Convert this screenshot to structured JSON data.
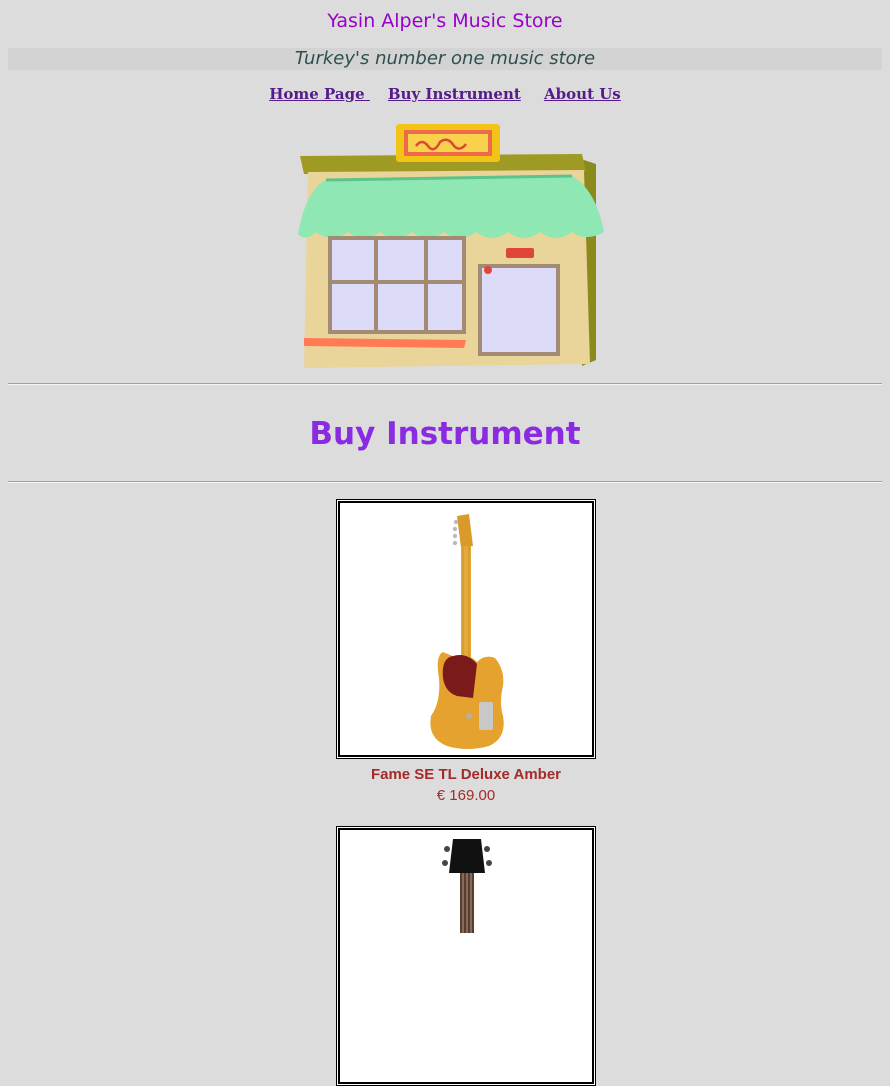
{
  "header": {
    "title": "Yasin Alper's Music Store",
    "tagline": "Turkey's number one music store"
  },
  "nav": {
    "items": [
      {
        "label": "Home Page "
      },
      {
        "label": "Buy Instrument"
      },
      {
        "label": " About Us"
      }
    ]
  },
  "store_image": {
    "icon": "music-store-building-illustration"
  },
  "section": {
    "title": "Buy Instrument"
  },
  "products": [
    {
      "name": "Fame SE TL Deluxe Amber",
      "price": "€ 169.00",
      "icon": "electric-guitar-image"
    },
    {
      "name": "",
      "price": "",
      "icon": "ukulele-image"
    }
  ],
  "colors": {
    "background": "#dcdcdc",
    "title": "#9900cc",
    "tagline": "#2f4f4f",
    "nav_link": "#551a8b",
    "section_title": "#8a2be2",
    "product_text": "#a52a2a"
  }
}
